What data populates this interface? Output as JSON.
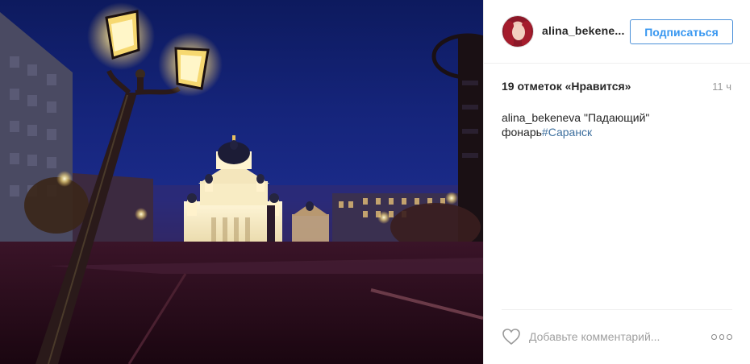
{
  "photo": {
    "alt": "night street lamp with cathedral"
  },
  "header": {
    "username": "alina_bekene...",
    "follow_label": "Подписаться"
  },
  "stats": {
    "likes": "19 отметок «Нравится»",
    "time": "11 ч"
  },
  "caption": {
    "author": "alina_bekeneva",
    "text": " \"Падающий\" фонарь",
    "hashtag": "#Саранск"
  },
  "footer": {
    "comment_placeholder": "Добавьте комментарий..."
  },
  "icons": {
    "like": "heart-icon",
    "more": "more-options-icon"
  },
  "colors": {
    "accent": "#3897f0",
    "hashtag": "#3d6f9e"
  }
}
